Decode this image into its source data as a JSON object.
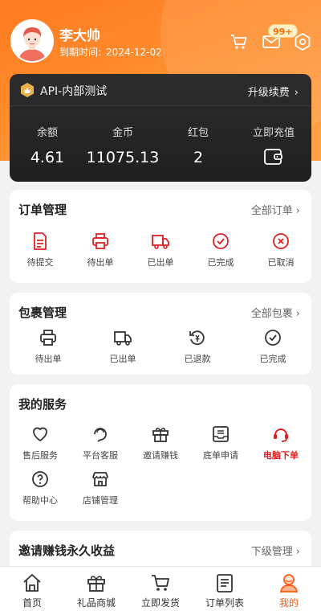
{
  "user": {
    "name": "李大帅",
    "expire_label": "到期时间:",
    "expire_date": "2024-12-02"
  },
  "header": {
    "message_badge": "99+"
  },
  "vip": {
    "title": "API-内部测试",
    "renew_label": "升级续费",
    "stats": [
      {
        "label": "余额",
        "value": "4.61"
      },
      {
        "label": "金币",
        "value": "11075.13"
      },
      {
        "label": "红包",
        "value": "2"
      },
      {
        "label": "立即充值",
        "value": ""
      }
    ]
  },
  "orders": {
    "title": "订单管理",
    "more": "全部订单",
    "items": [
      {
        "label": "待提交",
        "icon": "document-icon"
      },
      {
        "label": "待出单",
        "icon": "printer-icon"
      },
      {
        "label": "已出单",
        "icon": "truck-icon"
      },
      {
        "label": "已完成",
        "icon": "check-circle-icon"
      },
      {
        "label": "已取消",
        "icon": "x-circle-icon"
      }
    ]
  },
  "parcels": {
    "title": "包裹管理",
    "more": "全部包裹",
    "items": [
      {
        "label": "待出单",
        "icon": "printer-icon"
      },
      {
        "label": "已出单",
        "icon": "truck-icon"
      },
      {
        "label": "已退款",
        "icon": "refund-icon"
      },
      {
        "label": "已完成",
        "icon": "check-circle-icon"
      }
    ]
  },
  "services": {
    "title": "我的服务",
    "items": [
      {
        "label": "售后服务",
        "icon": "heart-icon"
      },
      {
        "label": "平台客服",
        "icon": "customer-service-icon"
      },
      {
        "label": "邀请赚钱",
        "icon": "gift-icon"
      },
      {
        "label": "底单申请",
        "icon": "inbox-icon"
      },
      {
        "label": "电脑下单",
        "icon": "headset-icon"
      },
      {
        "label": "帮助中心",
        "icon": "help-icon"
      },
      {
        "label": "店铺管理",
        "icon": "store-icon"
      }
    ]
  },
  "invite": {
    "title": "邀请赚钱永久收益",
    "more": "下级管理"
  },
  "tabs": [
    {
      "label": "首页",
      "icon": "home-icon"
    },
    {
      "label": "礼品商城",
      "icon": "gift-icon"
    },
    {
      "label": "立即发货",
      "icon": "cart-icon"
    },
    {
      "label": "订单列表",
      "icon": "list-icon"
    },
    {
      "label": "我的",
      "icon": "profile-icon"
    }
  ],
  "colors": {
    "brand_orange": "#ff7a1f",
    "accent_red": "#e02020",
    "active_tab": "#ff5a14",
    "card_dark": "#222222"
  }
}
